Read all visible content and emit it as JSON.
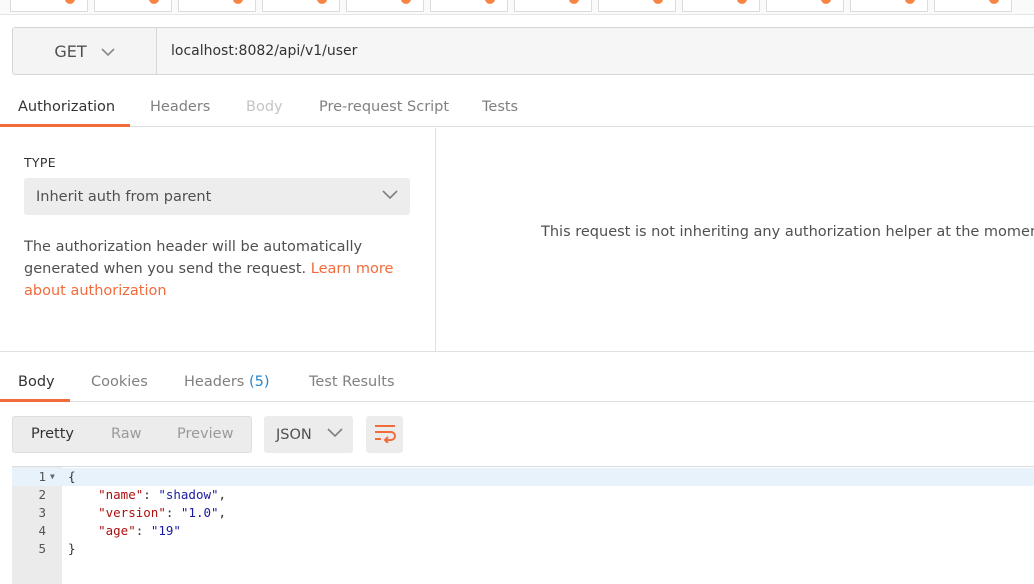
{
  "request": {
    "method": "GET",
    "url": "localhost:8082/api/v1/user",
    "tabs": [
      {
        "label": "Authorization",
        "active": true,
        "disabled": false
      },
      {
        "label": "Headers",
        "active": false,
        "disabled": false
      },
      {
        "label": "Body",
        "active": false,
        "disabled": true
      },
      {
        "label": "Pre-request Script",
        "active": false,
        "disabled": false
      },
      {
        "label": "Tests",
        "active": false,
        "disabled": false
      }
    ]
  },
  "auth": {
    "type_label": "TYPE",
    "type_value": "Inherit auth from parent",
    "desc_text": "The authorization header will be automatically generated when you send the request. ",
    "desc_link": "Learn more about authorization",
    "message": "This request is not inheriting any authorization helper at the moment. S"
  },
  "response": {
    "tabs": [
      {
        "label": "Body",
        "active": true
      },
      {
        "label": "Cookies",
        "active": false
      },
      {
        "label": "Headers",
        "count": "(5)",
        "active": false
      },
      {
        "label": "Test Results",
        "active": false
      }
    ],
    "view_modes": [
      "Pretty",
      "Raw",
      "Preview"
    ],
    "active_view": "Pretty",
    "format": "JSON"
  },
  "code": {
    "line_numbers": [
      "1",
      "2",
      "3",
      "4",
      "5"
    ],
    "open_brace": "{",
    "close_brace": "}",
    "fields": [
      {
        "key": "\"name\"",
        "value": "\"shadow\"",
        "comma": ","
      },
      {
        "key": "\"version\"",
        "value": "\"1.0\"",
        "comma": ","
      },
      {
        "key": "\"age\"",
        "value": "\"19\"",
        "comma": ""
      }
    ]
  },
  "colors": {
    "accent": "#f26b3a",
    "count_blue": "#2a86c8",
    "json_key": "#a11",
    "json_string": "#1a1aa6"
  },
  "icons": [
    "chevron-down-icon",
    "wrap-lines-icon",
    "fold-arrow-icon"
  ]
}
